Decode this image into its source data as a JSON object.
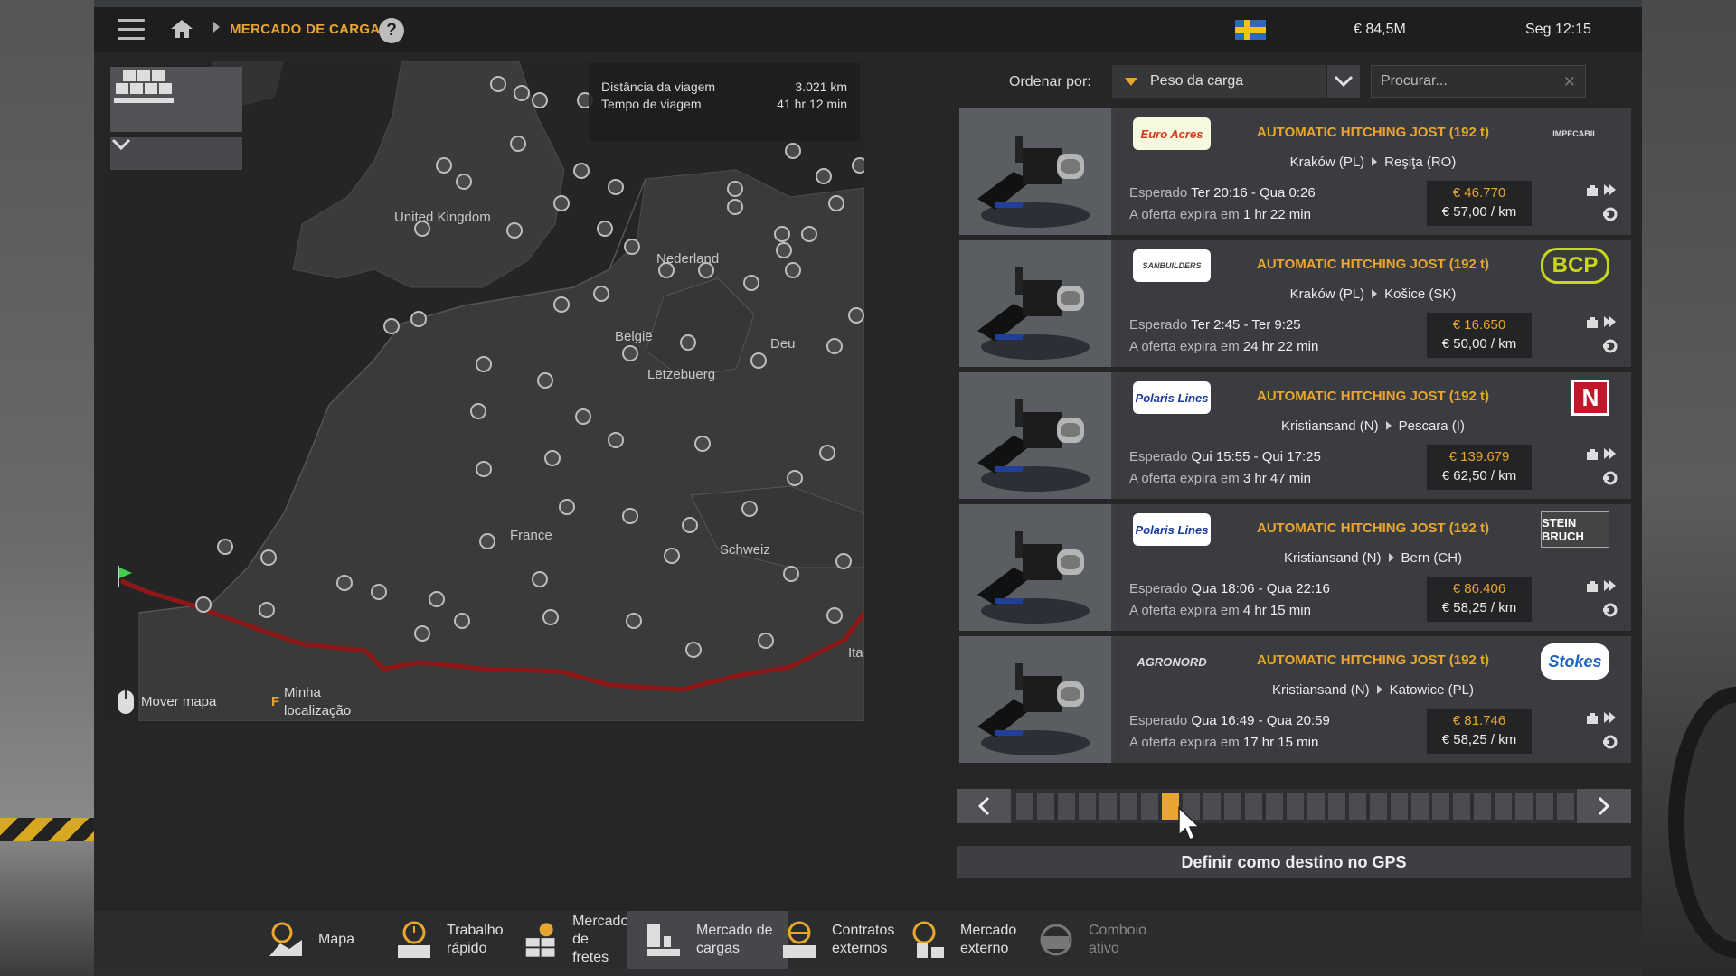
{
  "topbar": {
    "breadcrumb": "MERCADO DE CARGAS",
    "help": "?",
    "money": "€ 84,5M",
    "clock": "Seg 12:15"
  },
  "map": {
    "labels": [
      "United Kingdom",
      "Nederland",
      "België",
      "Lëtzebuerg",
      "Deu",
      "France",
      "Schweiz",
      "Ita"
    ],
    "trip": {
      "distance_label": "Distância da viagem",
      "distance_value": "3.021 km",
      "time_label": "Tempo de viagem",
      "time_value": "41 hr 12 min"
    },
    "hint_move": "Mover mapa",
    "hint_key": "F",
    "hint_location_1": "Minha",
    "hint_location_2": "localização"
  },
  "sort": {
    "label": "Ordenar por:",
    "selected": "Peso da carga"
  },
  "search": {
    "placeholder": "Procurar..."
  },
  "cargos": [
    {
      "logo_left": "Euro Acres",
      "title": "AUTOMATIC HITCHING JOST (192 t)",
      "from": "Kraków (PL)",
      "to": "Reşiţa (RO)",
      "expected_label": "Esperado",
      "expected": "Ter 20:16 - Qua 0:26",
      "offer_label": "A oferta expira em",
      "offer": "1 hr 22 min",
      "price": "€ 46.770",
      "per_km": "€ 57,00 / km",
      "logo_right": "IMPECABIL"
    },
    {
      "logo_left": "SANBUILDERS",
      "title": "AUTOMATIC HITCHING JOST (192 t)",
      "from": "Kraków (PL)",
      "to": "Košice (SK)",
      "expected_label": "Esperado",
      "expected": "Ter 2:45 - Ter 9:25",
      "offer_label": "A oferta expira em",
      "offer": "24 hr 22 min",
      "price": "€ 16.650",
      "per_km": "€ 50,00 / km",
      "logo_right": "BCP"
    },
    {
      "logo_left": "Polaris Lines",
      "title": "AUTOMATIC HITCHING JOST (192 t)",
      "from": "Kristiansand (N)",
      "to": "Pescara (I)",
      "expected_label": "Esperado",
      "expected": "Qui 15:55 - Qui 17:25",
      "offer_label": "A oferta expira em",
      "offer": "3 hr 47 min",
      "price": "€ 139.679",
      "per_km": "€ 62,50 / km",
      "logo_right": "N"
    },
    {
      "logo_left": "Polaris Lines",
      "title": "AUTOMATIC HITCHING JOST (192 t)",
      "from": "Kristiansand (N)",
      "to": "Bern (CH)",
      "expected_label": "Esperado",
      "expected": "Qua 18:06 - Qua 22:16",
      "offer_label": "A oferta expira em",
      "offer": "4 hr 15 min",
      "price": "€ 86.406",
      "per_km": "€ 58,25 / km",
      "logo_right": "STEIN BRUCH"
    },
    {
      "logo_left": "AGRONORD",
      "title": "AUTOMATIC HITCHING JOST (192 t)",
      "from": "Kristiansand (N)",
      "to": "Katowice (PL)",
      "expected_label": "Esperado",
      "expected": "Qua 16:49 - Qua 20:59",
      "offer_label": "A oferta expira em",
      "offer": "17 hr 15 min",
      "price": "€ 81.746",
      "per_km": "€ 58,25 / km",
      "logo_right": "Stokes"
    }
  ],
  "pager": {
    "pages": 27,
    "active_index": 7
  },
  "gps_button": "Definir como destino no GPS",
  "nav": [
    {
      "label1": "Mapa",
      "label2": "",
      "icon": "map-icon"
    },
    {
      "label1": "Trabalho",
      "label2": "rápido",
      "icon": "quick-job-icon"
    },
    {
      "label1": "Mercado de",
      "label2": "fretes",
      "icon": "freight-market-icon"
    },
    {
      "label1": "Mercado de",
      "label2": "cargas",
      "icon": "cargo-market-icon"
    },
    {
      "label1": "Contratos",
      "label2": "externos",
      "icon": "external-contracts-icon"
    },
    {
      "label1": "Mercado",
      "label2": "externo",
      "icon": "external-market-icon"
    },
    {
      "label1": "Comboio",
      "label2": "ativo",
      "icon": "convoy-icon"
    }
  ],
  "colors": {
    "accent": "#e8a630",
    "route": "#9b1b1b",
    "panel": "#3a3c3f"
  }
}
